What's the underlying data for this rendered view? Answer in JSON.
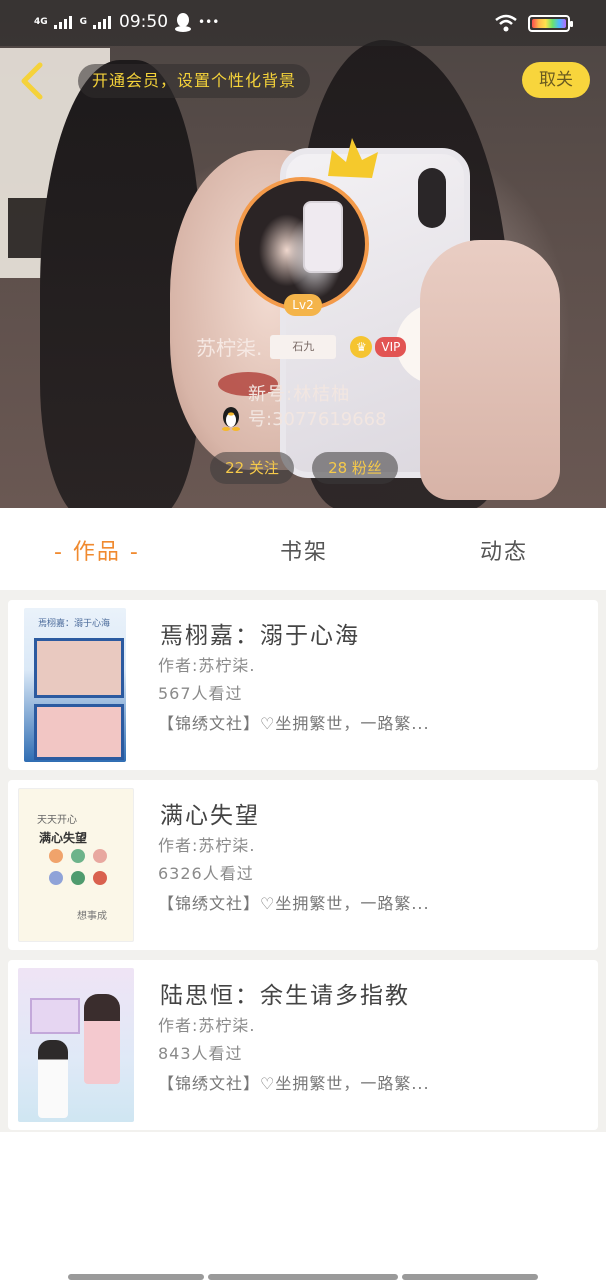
{
  "status_bar": {
    "network1": "4G",
    "network2": "G",
    "time": "09:50",
    "more": "•••"
  },
  "header": {
    "vip_banner": "开通会员，设置个性化背景",
    "close_label": "取关",
    "level": "Lv2",
    "username": "苏柠柒.",
    "tag_text": "石九",
    "vip_label": "VIP",
    "new_id": "新号:林桔柚",
    "qq_number": "号:3077619668",
    "following": "22 关注",
    "fans": "28 粉丝"
  },
  "tabs": [
    {
      "label": "- 作品 -",
      "active": true
    },
    {
      "label": "书架",
      "active": false
    },
    {
      "label": "动态",
      "active": false
    }
  ],
  "works": [
    {
      "title": "焉栩嘉：溺于心海",
      "author": "作者:苏柠柒.",
      "views": "567人看过",
      "desc": "【锦绣文社】♡坐拥繁世，一路繁..."
    },
    {
      "title": "满心失望",
      "author": "作者:苏柠柒.",
      "views": "6326人看过",
      "desc": "【锦绣文社】♡坐拥繁世，一路繁..."
    },
    {
      "title": "陆思恒：余生请多指教",
      "author": "作者:苏柠柒.",
      "views": "843人看过",
      "desc": "【锦绣文社】♡坐拥繁世，一路繁..."
    }
  ],
  "covers": {
    "cover1_text": "焉栩嘉：溺于心海",
    "cover2_title": "满心失望",
    "cover2_top": "天天开心",
    "cover2_sign": "想事成"
  },
  "colors": {
    "accent": "#f08a2f",
    "vip_yellow": "#f8d53c",
    "level": "#f4b44a"
  }
}
